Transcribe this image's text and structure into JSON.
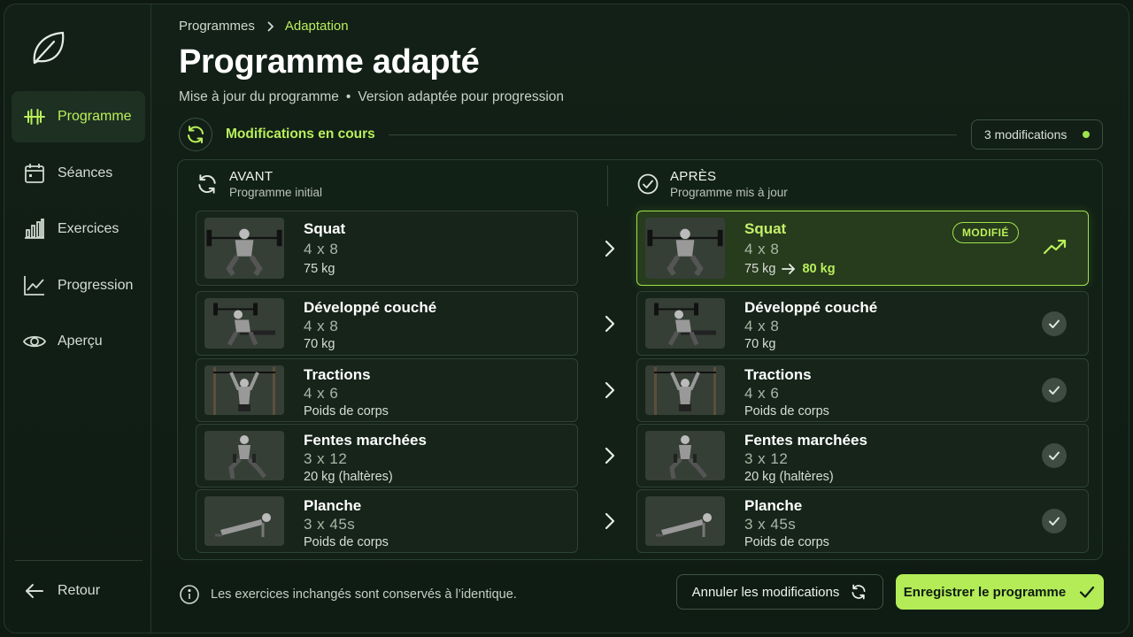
{
  "sidebar": {
    "logo": "leaf-icon",
    "items": [
      {
        "label": "Programme",
        "icon": "dumbbell-icon",
        "active": true
      },
      {
        "label": "Séances",
        "icon": "calendar-icon"
      },
      {
        "label": "Exercices",
        "icon": "bar-chart-icon"
      },
      {
        "label": "Progression",
        "icon": "line-chart-icon"
      },
      {
        "label": "Aperçu",
        "icon": "eye-icon"
      }
    ],
    "back_label": "Retour"
  },
  "breadcrumb": {
    "parent": "Programmes",
    "current": "Adaptation"
  },
  "page": {
    "title": "Programme adapté",
    "subtitle_left": "Mise à jour du programme",
    "subtitle_sep": "•",
    "subtitle_right": "Version adaptée pour progression"
  },
  "modifications": {
    "label": "Modifications en cours",
    "count_label": "3 modifications"
  },
  "columns": {
    "before": {
      "title": "AVANT",
      "subtitle": "Programme initial"
    },
    "after": {
      "title": "APRÈS",
      "subtitle": "Programme mis à jour"
    }
  },
  "exercises": [
    {
      "name": "Squat",
      "sets": "4 x 8",
      "load": "75 kg",
      "new_load": "80 kg",
      "modified": true
    },
    {
      "name": "Développé couché",
      "sets": "4 x 8",
      "load": "70 kg"
    },
    {
      "name": "Tractions",
      "sets": "4 x 6",
      "load": "Poids de corps"
    },
    {
      "name": "Fentes marchées",
      "sets": "3 x 12",
      "load": "20 kg (haltères)"
    },
    {
      "name": "Planche",
      "sets": "3 x 45s",
      "load": "Poids de corps"
    }
  ],
  "modified_badge": "MODIFIÉ",
  "footer": {
    "info": "Les exercices inchangés sont conservés à l’identique.",
    "cancel_label": "Annuler les modifications",
    "save_label": "Enregistrer le programme"
  },
  "colors": {
    "accent": "#b3ec57",
    "background": "#0e1a12"
  }
}
